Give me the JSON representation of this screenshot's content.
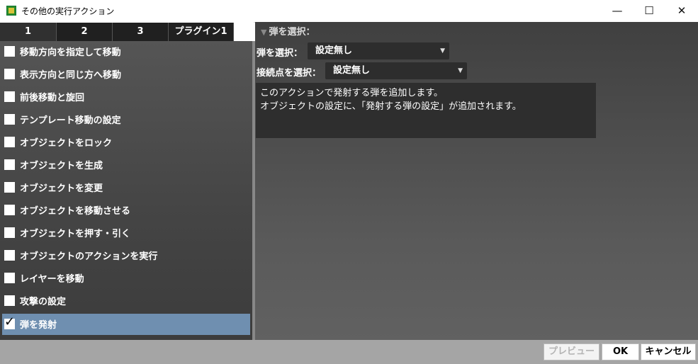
{
  "window": {
    "title": "その他の実行アクション",
    "minimize": "—",
    "maximize": "☐",
    "close": "✕"
  },
  "tabs": [
    {
      "label": "1"
    },
    {
      "label": "2"
    },
    {
      "label": "3"
    },
    {
      "label": "プラグイン1"
    }
  ],
  "actions": [
    {
      "label": "移動方向を指定して移動",
      "checked": false
    },
    {
      "label": "表示方向と同じ方へ移動",
      "checked": false
    },
    {
      "label": "前後移動と旋回",
      "checked": false
    },
    {
      "label": "テンプレート移動の設定",
      "checked": false
    },
    {
      "label": "オブジェクトをロック",
      "checked": false
    },
    {
      "label": "オブジェクトを生成",
      "checked": false
    },
    {
      "label": "オブジェクトを変更",
      "checked": false
    },
    {
      "label": "オブジェクトを移動させる",
      "checked": false
    },
    {
      "label": "オブジェクトを押す・引く",
      "checked": false
    },
    {
      "label": "オブジェクトのアクションを実行",
      "checked": false
    },
    {
      "label": "レイヤーを移動",
      "checked": false
    },
    {
      "label": "攻撃の設定",
      "checked": false
    },
    {
      "label": "弾を発射",
      "checked": true,
      "selected": true
    }
  ],
  "settings": {
    "section_title": "弾を選択：",
    "bullet_label": "弾を選択：",
    "bullet_value": "設定無し",
    "connect_label": "接続点を選択：",
    "connect_value": "設定無し",
    "description_line1": "このアクションで発射する弾を追加します。",
    "description_line2": "オブジェクトの設定に、「発射する弾の設定」が追加されます。"
  },
  "footer": {
    "preview": "プレビュー",
    "ok": "OK",
    "cancel": "キャンセル"
  },
  "colors": {
    "selected_row": "#6f8fb0",
    "panel_bg": "#4a4a4a",
    "footer_bg": "#a5a5a5"
  }
}
